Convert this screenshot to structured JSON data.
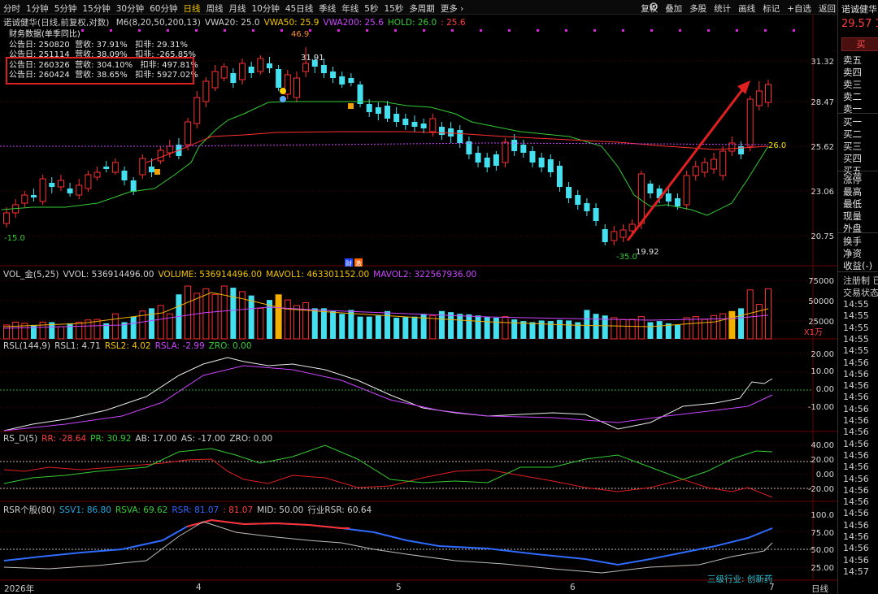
{
  "toolbar": {
    "periods": [
      "分时",
      "1分钟",
      "5分钟",
      "15分钟",
      "30分钟",
      "60分钟",
      "日线",
      "周线",
      "月线",
      "10分钟",
      "45日线",
      "季线",
      "年线",
      "5秒",
      "15秒",
      "多周期",
      "更多 ›"
    ],
    "active_period": "日线",
    "tools": [
      "复权",
      "叠加",
      "多股",
      "统计",
      "画线",
      "标记",
      "+自选",
      "返回"
    ]
  },
  "stock": {
    "name": "诺诚健华",
    "price": "29.57",
    "price_suffix": "1",
    "buy_label": "买"
  },
  "quote_panel": {
    "ask_labels": [
      "卖五",
      "卖四",
      "卖三",
      "卖二",
      "卖一"
    ],
    "bid_labels": [
      "买一",
      "买二",
      "买三",
      "买四",
      "买五"
    ],
    "stat_labels": [
      "涨停",
      "最高",
      "最低",
      "现量",
      "外盘"
    ],
    "extra_labels": [
      "换手",
      "净资",
      "收益(-)"
    ],
    "status": [
      "注册制 已",
      "交易状态"
    ],
    "times": [
      "14:55",
      "14:55",
      "14:55",
      "14:55",
      "14:55",
      "14:56",
      "14:56",
      "14:56",
      "14:56",
      "14:56",
      "14:56",
      "14:56",
      "14:56",
      "14:56",
      "14:56",
      "14:56",
      "14:56",
      "14:56",
      "14:56",
      "14:56",
      "14:56",
      "14:56",
      "14:56",
      "14:57"
    ]
  },
  "price_panel": {
    "title": "诺诚健华(日线,前复权,对数)",
    "indicators": [
      {
        "text": "M6(8,20,50,200,13)",
        "color": "#d0d0d0"
      },
      {
        "text": "VWA20: 25.0",
        "color": "#d0d0d0"
      },
      {
        "text": "VWA50: 25.9",
        "color": "#f3c400"
      },
      {
        "text": "VWA200: 25.6",
        "color": "#cc44ff"
      },
      {
        "text": "HOLD: 26.0",
        "color": "#33cc33"
      },
      {
        "text": ": 25.6",
        "color": "#ff4040"
      }
    ],
    "financial": {
      "title": "财务数据(单季同比)",
      "rows": [
        "公告日: 250820  营收: 37.91%   扣非: 29.31%",
        "公告日: 251114  营收: 38.09%   扣非: -265.85%",
        "公告日: 260326  营收: 304.10%   扣非: 497.81%",
        "公告日: 260424  营收: 38.65%   扣非: 5927.02%"
      ]
    },
    "y_ticks": [
      "31.32",
      "28.47",
      "25.62",
      "23.06",
      "20.75"
    ],
    "labels": {
      "high_value": "46.9",
      "max_price": "31.91",
      "min_price": "19.92",
      "left_value": "-15.0",
      "low_value": "-35.0",
      "hold_value": "26.0",
      "badge_cai": "财",
      "badge_ji": "激"
    }
  },
  "volume_panel": {
    "indicators": [
      {
        "text": "VOL_金(5,25)",
        "color": "#d0d0d0"
      },
      {
        "text": "VVOL: 536914496.00",
        "color": "#d0d0d0"
      },
      {
        "text": "VOLUME: 536914496.00",
        "color": "#f3c400"
      },
      {
        "text": "MAVOL1: 463301152.00",
        "color": "#f3c400"
      },
      {
        "text": "MAVOL2: 322567936.00",
        "color": "#cc44ff"
      }
    ],
    "y_ticks": [
      "75000",
      "50000",
      "25000"
    ],
    "unit": "X1万"
  },
  "rsl_panel": {
    "indicators": [
      {
        "text": "RSL(144,9)",
        "color": "#d0d0d0"
      },
      {
        "text": "RSL1: 4.71",
        "color": "#d0d0d0"
      },
      {
        "text": "RSL2: 4.02",
        "color": "#f3c400"
      },
      {
        "text": "RSLA: -2.99",
        "color": "#cc44ff"
      },
      {
        "text": "ZRO: 0.00",
        "color": "#33cc33"
      }
    ],
    "y_ticks": [
      "20.00",
      "10.00",
      "0.00",
      "-10.00"
    ]
  },
  "rsd_panel": {
    "indicators": [
      {
        "text": "RS_D(5)",
        "color": "#d0d0d0"
      },
      {
        "text": "RR: -28.64",
        "color": "#ff4040"
      },
      {
        "text": "PR: 30.92",
        "color": "#33cc33"
      },
      {
        "text": "AB: 17.00",
        "color": "#d0d0d0"
      },
      {
        "text": "AS: -17.00",
        "color": "#d0d0d0"
      },
      {
        "text": "ZRO: 0.00",
        "color": "#d0d0d0"
      }
    ],
    "y_ticks": [
      "40.00",
      "20.00",
      "0.00",
      "-20.00"
    ]
  },
  "rsr_panel": {
    "indicators": [
      {
        "text": "RSR个股(80)",
        "color": "#d0d0d0"
      },
      {
        "text": "SSV1: 86.80",
        "color": "#22aadd"
      },
      {
        "text": "RSVA: 69.62",
        "color": "#33cc33"
      },
      {
        "text": "RSR: 81.07",
        "color": "#3366ff"
      },
      {
        "text": ": 81.07",
        "color": "#ff4040"
      },
      {
        "text": "MID: 50.00",
        "color": "#d0d0d0"
      },
      {
        "text": "行业RSR: 60.64",
        "color": "#d0d0d0"
      }
    ],
    "y_ticks": [
      "100.0",
      "75.00",
      "50.00",
      "25.00"
    ],
    "industry": "三级行业: 创新药"
  },
  "x_axis": {
    "labels": [
      "2026年",
      "4",
      "5",
      "6",
      "7"
    ],
    "period": "日线"
  },
  "colors": {
    "up": "#ff3030",
    "down": "#44e0f0",
    "ma_green": "#33cc33",
    "ma_red": "#ff3030",
    "ma_purple": "#cc44ff",
    "arrow": "#e02020",
    "grid": "#3a0000"
  }
}
